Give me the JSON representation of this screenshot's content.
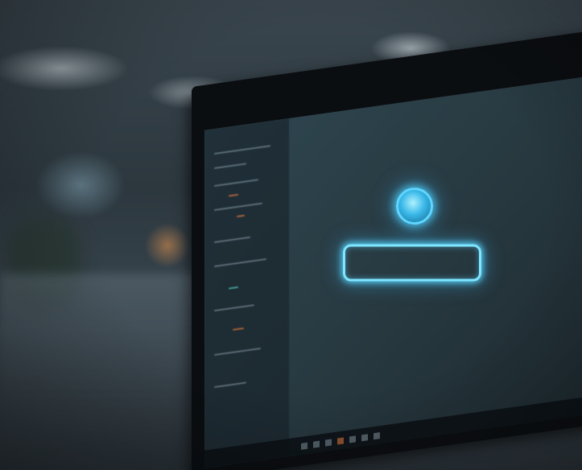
{
  "scene": {
    "accent_glow_color": "#7fe6ff",
    "icons": [
      "avatar-circle-icon",
      "chat-bubble-icon"
    ]
  }
}
